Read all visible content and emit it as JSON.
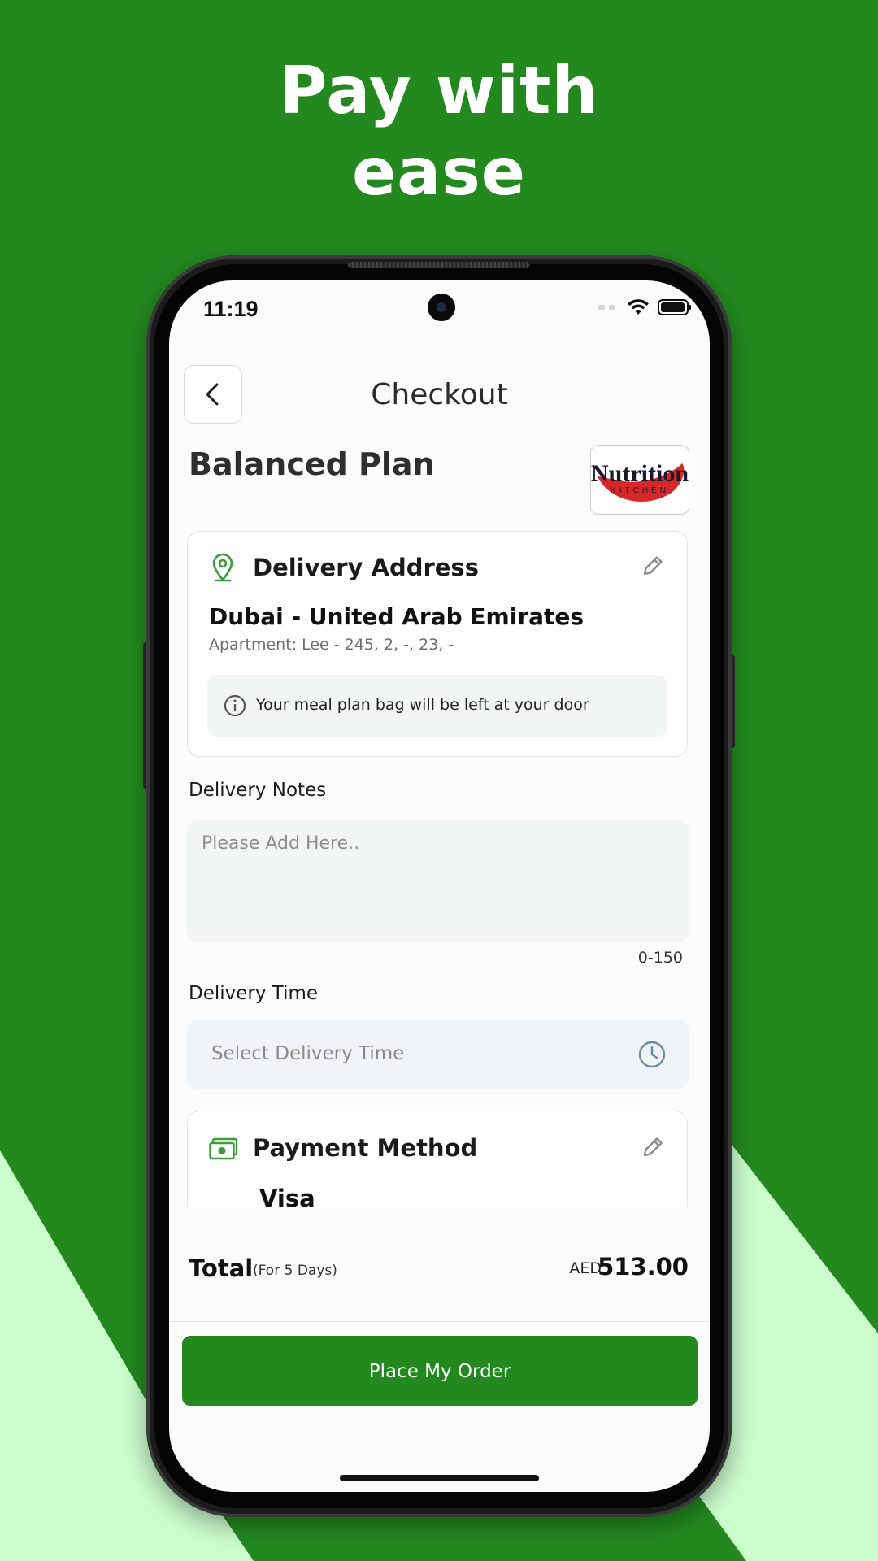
{
  "headline": [
    "Pay with",
    "ease"
  ],
  "colors": {
    "brand_green": "#23891f",
    "light_green": "#cbfdcd",
    "icon_green": "#3a9a3c"
  },
  "status_bar": {
    "time": "11:19",
    "icons": [
      "signal-icon",
      "wifi-icon",
      "battery-icon"
    ]
  },
  "header": {
    "title": "Checkout",
    "back_icon": "chevron-left-icon"
  },
  "plan": {
    "title": "Balanced Plan",
    "logo_text_main": "Nutrition",
    "logo_text_sub": "KITCHEN"
  },
  "delivery_address": {
    "title": "Delivery Address",
    "address_line": "Dubai - United Arab Emirates",
    "address_detail": "Apartment: Lee - 245, 2, -, 23, -",
    "info": "Your meal plan bag will be left at your door"
  },
  "delivery_notes": {
    "label": "Delivery Notes",
    "placeholder": "Please Add Here..",
    "value": "",
    "counter": "0-150"
  },
  "delivery_time": {
    "label": "Delivery Time",
    "placeholder": "Select Delivery Time"
  },
  "payment_method": {
    "title": "Payment Method",
    "selected": "Visa"
  },
  "total": {
    "label": "Total",
    "days_note": "(For 5 Days)",
    "currency": "AED",
    "amount": "513.00"
  },
  "cta": {
    "label": "Place My Order"
  }
}
